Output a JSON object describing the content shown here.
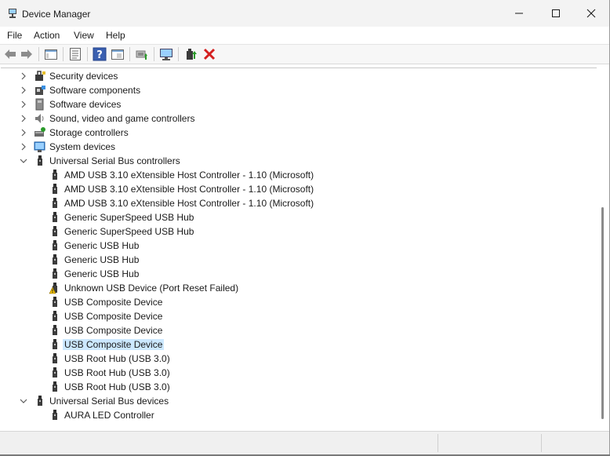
{
  "window": {
    "title": "Device Manager",
    "controls": {
      "minimize": "minimize",
      "maximize": "maximize",
      "close": "close"
    }
  },
  "menu": [
    "File",
    "Action",
    "View",
    "Help"
  ],
  "toolbar": [
    "back-icon",
    "forward-icon",
    "properties-window-icon",
    "list-view-icon",
    "help-icon",
    "computer-view-icon",
    "update-driver-icon",
    "scan-hardware-icon",
    "enable-device-icon",
    "uninstall-device-icon"
  ],
  "tree": {
    "rows": [
      {
        "label": "Security devices",
        "level": 0,
        "expander": "collapsed",
        "icon": "security-device-icon"
      },
      {
        "label": "Software components",
        "level": 0,
        "expander": "collapsed",
        "icon": "software-component-icon"
      },
      {
        "label": "Software devices",
        "level": 0,
        "expander": "collapsed",
        "icon": "software-device-icon"
      },
      {
        "label": "Sound, video and game controllers",
        "level": 0,
        "expander": "collapsed",
        "icon": "speaker-icon"
      },
      {
        "label": "Storage controllers",
        "level": 0,
        "expander": "collapsed",
        "icon": "storage-controller-icon"
      },
      {
        "label": "System devices",
        "level": 0,
        "expander": "collapsed",
        "icon": "system-device-icon"
      },
      {
        "label": "Universal Serial Bus controllers",
        "level": 0,
        "expander": "expanded",
        "icon": "usb-icon"
      },
      {
        "label": "AMD USB 3.10 eXtensible Host Controller - 1.10 (Microsoft)",
        "level": 1,
        "icon": "usb-icon"
      },
      {
        "label": "AMD USB 3.10 eXtensible Host Controller - 1.10 (Microsoft)",
        "level": 1,
        "icon": "usb-icon"
      },
      {
        "label": "AMD USB 3.10 eXtensible Host Controller - 1.10 (Microsoft)",
        "level": 1,
        "icon": "usb-icon"
      },
      {
        "label": "Generic SuperSpeed USB Hub",
        "level": 1,
        "icon": "usb-icon"
      },
      {
        "label": "Generic SuperSpeed USB Hub",
        "level": 1,
        "icon": "usb-icon"
      },
      {
        "label": "Generic USB Hub",
        "level": 1,
        "icon": "usb-icon"
      },
      {
        "label": "Generic USB Hub",
        "level": 1,
        "icon": "usb-icon"
      },
      {
        "label": "Generic USB Hub",
        "level": 1,
        "icon": "usb-icon"
      },
      {
        "label": "Unknown USB Device (Port Reset Failed)",
        "level": 1,
        "icon": "warning-icon"
      },
      {
        "label": "USB Composite Device",
        "level": 1,
        "icon": "usb-icon"
      },
      {
        "label": "USB Composite Device",
        "level": 1,
        "icon": "usb-icon"
      },
      {
        "label": "USB Composite Device",
        "level": 1,
        "icon": "usb-icon"
      },
      {
        "label": "USB Composite Device",
        "level": 1,
        "icon": "usb-icon",
        "selected": true
      },
      {
        "label": "USB Root Hub (USB 3.0)",
        "level": 1,
        "icon": "usb-icon"
      },
      {
        "label": "USB Root Hub (USB 3.0)",
        "level": 1,
        "icon": "usb-icon"
      },
      {
        "label": "USB Root Hub (USB 3.0)",
        "level": 1,
        "icon": "usb-icon"
      },
      {
        "label": "Universal Serial Bus devices",
        "level": 0,
        "expander": "expanded",
        "icon": "usb-icon"
      },
      {
        "label": "AURA LED Controller",
        "level": 1,
        "icon": "usb-icon"
      }
    ]
  },
  "colors": {
    "selection": "#cce8ff",
    "uninstall": "#d42020",
    "warning": "#f2c200",
    "titlebar": "#f3f3f3"
  }
}
